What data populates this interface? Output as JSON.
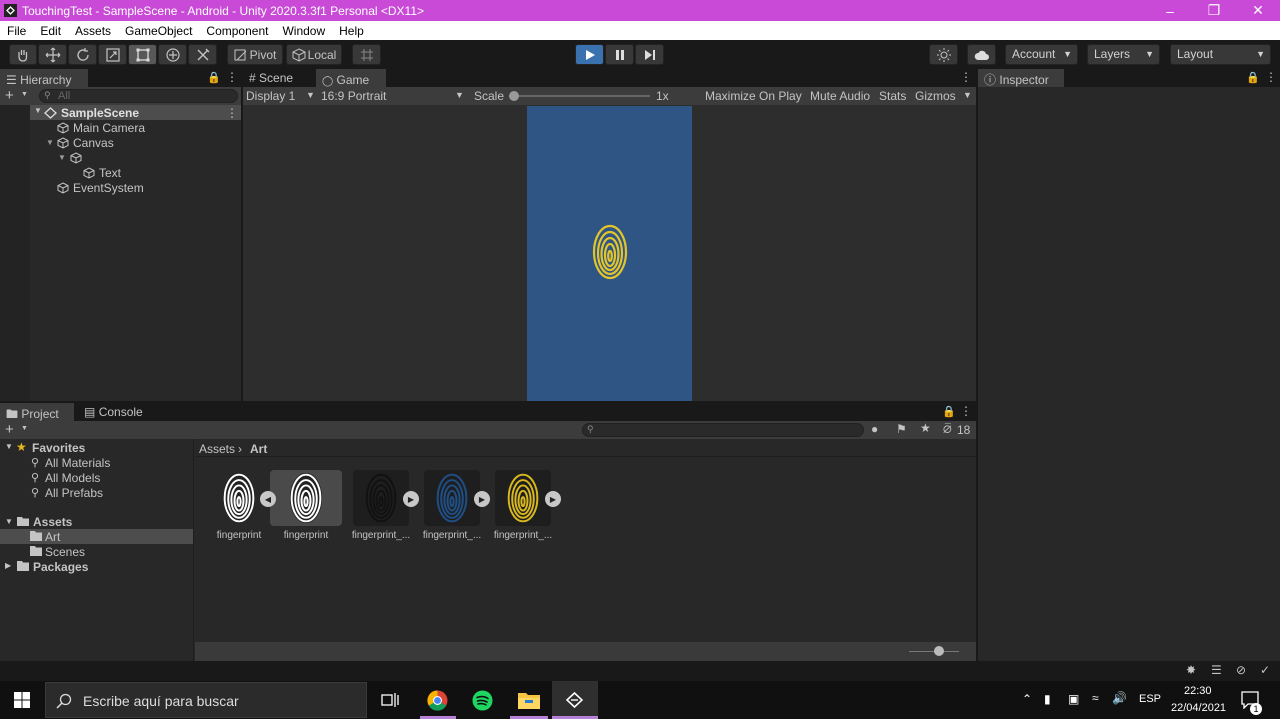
{
  "window": {
    "title": "TouchingTest - SampleScene - Android - Unity 2020.3.3f1 Personal <DX11>"
  },
  "menu": [
    "File",
    "Edit",
    "Assets",
    "GameObject",
    "Component",
    "Window",
    "Help"
  ],
  "toolbar": {
    "pivot": "Pivot",
    "local": "Local",
    "account": "Account",
    "layers": "Layers",
    "layout": "Layout"
  },
  "hierarchy": {
    "tab": "Hierarchy",
    "search_placeholder": "All",
    "scene": "SampleScene",
    "items": [
      "Main Camera",
      "Canvas",
      "Text",
      "EventSystem"
    ]
  },
  "game": {
    "tabs": [
      "Scene",
      "Game"
    ],
    "display": "Display 1",
    "aspect": "16:9 Portrait",
    "scale_label": "Scale",
    "scale_value": "1x",
    "maximize": "Maximize On Play",
    "mute": "Mute Audio",
    "stats": "Stats",
    "gizmos": "Gizmos",
    "colors": {
      "game_bg": "#2f5585",
      "fingerprint": "#e3c52a"
    }
  },
  "inspector": {
    "tab": "Inspector"
  },
  "project": {
    "tabs": [
      "Project",
      "Console"
    ],
    "hidden_count": "18",
    "favorites": {
      "label": "Favorites",
      "items": [
        "All Materials",
        "All Models",
        "All Prefabs"
      ]
    },
    "assets": {
      "label": "Assets",
      "items": [
        "Art",
        "Scenes"
      ]
    },
    "packages": "Packages",
    "breadcrumb": [
      "Assets",
      "Art"
    ],
    "files": [
      {
        "name": "fingerprint",
        "color": "#ffffff"
      },
      {
        "name": "fingerprint",
        "color": "#ffffff"
      },
      {
        "name": "fingerprint_...",
        "color": "#111111"
      },
      {
        "name": "fingerprint_...",
        "color": "#1e4f86"
      },
      {
        "name": "fingerprint_...",
        "color": "#d9b81e"
      }
    ]
  },
  "taskbar": {
    "search_placeholder": "Escribe aquí para buscar",
    "lang": "ESP",
    "time": "22:30",
    "date": "22/04/2021",
    "notif": "1"
  }
}
